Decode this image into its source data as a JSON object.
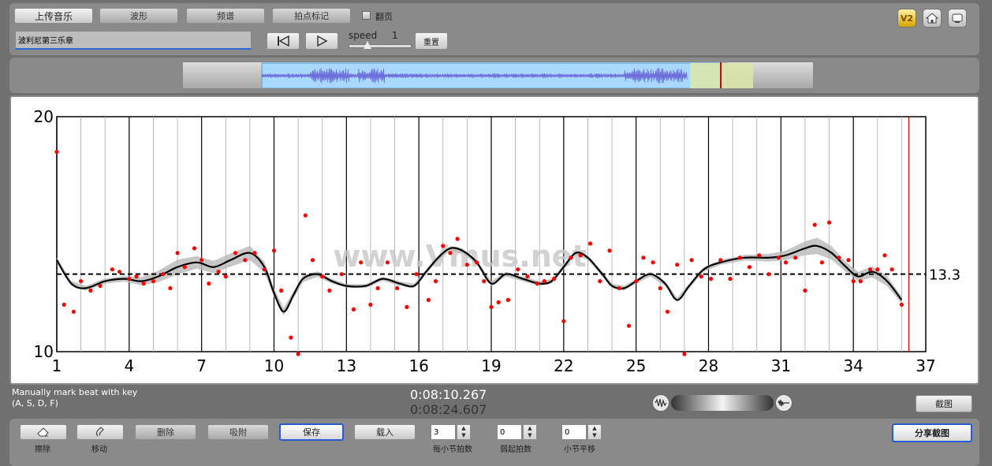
{
  "toolbar": {
    "upload_label": "上传音乐",
    "waveform_label": "波形",
    "spectrum_label": "频谱",
    "beat_mark_label": "拍点标记",
    "flip_label": "翻页",
    "title_value": "波利尼第三乐章",
    "speed_label": "speed",
    "speed_value": "1",
    "reset_label": "重置",
    "version_badge": "V2"
  },
  "chart_data": {
    "type": "line",
    "ylim": [
      10,
      20
    ],
    "xlim": [
      1,
      37
    ],
    "y_ticks": [
      "20",
      "10"
    ],
    "x_ticks": [
      "1",
      "4",
      "7",
      "10",
      "13",
      "16",
      "19",
      "22",
      "25",
      "28",
      "31",
      "34",
      "37"
    ],
    "mean_value": 13.3,
    "mean_label": "13.3",
    "watermark": "www.Vmus.net",
    "line_color": "#000000",
    "point_color": "#ff0000",
    "curve": [
      [
        1,
        13.9
      ],
      [
        1.6,
        12.9
      ],
      [
        2.2,
        12.7
      ],
      [
        3,
        13.0
      ],
      [
        3.8,
        13.1
      ],
      [
        4.5,
        13.0
      ],
      [
        5.2,
        13.2
      ],
      [
        6,
        13.6
      ],
      [
        6.8,
        13.8
      ],
      [
        7.5,
        13.6
      ],
      [
        8.2,
        13.9
      ],
      [
        9,
        14.2
      ],
      [
        9.6,
        13.6
      ],
      [
        10,
        12.5
      ],
      [
        10.4,
        11.7
      ],
      [
        10.8,
        12.4
      ],
      [
        11.2,
        13.1
      ],
      [
        11.8,
        13.3
      ],
      [
        12.4,
        13.0
      ],
      [
        13,
        12.8
      ],
      [
        13.8,
        12.8
      ],
      [
        14.5,
        13.1
      ],
      [
        15.2,
        12.9
      ],
      [
        15.8,
        12.8
      ],
      [
        16.3,
        13.4
      ],
      [
        16.8,
        14.0
      ],
      [
        17.3,
        14.4
      ],
      [
        17.8,
        14.3
      ],
      [
        18.4,
        13.8
      ],
      [
        19,
        12.9
      ],
      [
        19.6,
        13.3
      ],
      [
        20.3,
        13.1
      ],
      [
        21,
        12.9
      ],
      [
        21.5,
        13.0
      ],
      [
        22,
        13.6
      ],
      [
        22.5,
        14.2
      ],
      [
        23,
        14.0
      ],
      [
        23.6,
        13.3
      ],
      [
        24,
        12.8
      ],
      [
        24.5,
        12.7
      ],
      [
        25,
        13.0
      ],
      [
        25.6,
        13.3
      ],
      [
        26.2,
        12.9
      ],
      [
        26.7,
        12.2
      ],
      [
        27.2,
        12.8
      ],
      [
        27.8,
        13.5
      ],
      [
        28.5,
        13.8
      ],
      [
        29.5,
        14.0
      ],
      [
        30.5,
        14.0
      ],
      [
        31.2,
        14.1
      ],
      [
        32,
        14.4
      ],
      [
        32.5,
        14.5
      ],
      [
        33.1,
        14.2
      ],
      [
        33.7,
        13.6
      ],
      [
        34.2,
        13.2
      ],
      [
        34.8,
        13.4
      ],
      [
        35.4,
        13.0
      ],
      [
        36,
        12.2
      ]
    ],
    "band": [
      [
        1,
        0.12
      ],
      [
        2,
        0.1
      ],
      [
        4,
        0.12
      ],
      [
        6,
        0.32
      ],
      [
        7,
        0.25
      ],
      [
        9,
        0.3
      ],
      [
        10,
        0.18
      ],
      [
        13,
        0.08
      ],
      [
        17,
        0.1
      ],
      [
        22,
        0.1
      ],
      [
        29,
        0.1
      ],
      [
        31,
        0.18
      ],
      [
        32.5,
        0.35
      ],
      [
        34,
        0.18
      ],
      [
        35,
        0.25
      ],
      [
        36,
        0.15
      ]
    ],
    "points": [
      [
        1,
        18.5
      ],
      [
        1.3,
        12.0
      ],
      [
        1.7,
        11.7
      ],
      [
        2,
        13.0
      ],
      [
        2.4,
        12.6
      ],
      [
        2.8,
        12.8
      ],
      [
        3.3,
        13.5
      ],
      [
        3.6,
        13.4
      ],
      [
        4,
        13.1
      ],
      [
        4.3,
        13.2
      ],
      [
        4.6,
        12.9
      ],
      [
        5,
        13.0
      ],
      [
        5.4,
        13.3
      ],
      [
        5.7,
        12.7
      ],
      [
        6,
        14.2
      ],
      [
        6.3,
        13.6
      ],
      [
        6.7,
        14.4
      ],
      [
        7,
        13.9
      ],
      [
        7.3,
        12.9
      ],
      [
        7.7,
        13.4
      ],
      [
        8,
        13.2
      ],
      [
        8.4,
        14.2
      ],
      [
        8.8,
        13.9
      ],
      [
        9.2,
        14.2
      ],
      [
        9.6,
        13.5
      ],
      [
        10,
        14.3
      ],
      [
        10.3,
        12.6
      ],
      [
        10.7,
        10.6
      ],
      [
        11,
        9.9
      ],
      [
        11.3,
        15.8
      ],
      [
        11.6,
        13.9
      ],
      [
        12,
        13.2
      ],
      [
        12.3,
        12.6
      ],
      [
        12.8,
        13.3
      ],
      [
        13.3,
        11.8
      ],
      [
        13.6,
        13.8
      ],
      [
        14,
        12.0
      ],
      [
        14.3,
        12.7
      ],
      [
        14.7,
        13.8
      ],
      [
        15.1,
        12.7
      ],
      [
        15.5,
        11.9
      ],
      [
        15.9,
        13.3
      ],
      [
        16.4,
        12.2
      ],
      [
        16.7,
        13.0
      ],
      [
        17,
        14.5
      ],
      [
        17.3,
        14.2
      ],
      [
        17.6,
        14.8
      ],
      [
        18,
        13.7
      ],
      [
        18.4,
        13.8
      ],
      [
        18.7,
        13.0
      ],
      [
        19,
        11.9
      ],
      [
        19.3,
        12.1
      ],
      [
        19.7,
        12.2
      ],
      [
        20.1,
        13.5
      ],
      [
        20.5,
        13.2
      ],
      [
        20.9,
        12.9
      ],
      [
        21.2,
        13.0
      ],
      [
        21.6,
        13.1
      ],
      [
        22,
        11.3
      ],
      [
        22.3,
        14.0
      ],
      [
        22.7,
        14.1
      ],
      [
        23.1,
        14.6
      ],
      [
        23.5,
        13.0
      ],
      [
        23.9,
        14.3
      ],
      [
        24.3,
        12.7
      ],
      [
        24.7,
        11.1
      ],
      [
        25,
        13.0
      ],
      [
        25.3,
        14.0
      ],
      [
        25.7,
        13.8
      ],
      [
        26,
        12.7
      ],
      [
        26.3,
        11.7
      ],
      [
        26.7,
        13.7
      ],
      [
        27,
        9.9
      ],
      [
        27.3,
        13.9
      ],
      [
        27.7,
        13.2
      ],
      [
        28.1,
        13.1
      ],
      [
        28.5,
        13.9
      ],
      [
        28.9,
        13.1
      ],
      [
        29.3,
        14.0
      ],
      [
        29.7,
        13.6
      ],
      [
        30.1,
        14.1
      ],
      [
        30.5,
        13.3
      ],
      [
        30.9,
        14.0
      ],
      [
        31.2,
        13.8
      ],
      [
        31.6,
        14.0
      ],
      [
        32,
        12.6
      ],
      [
        32.4,
        15.4
      ],
      [
        32.7,
        13.8
      ],
      [
        33,
        15.5
      ],
      [
        33.4,
        14.0
      ],
      [
        33.8,
        13.9
      ],
      [
        34,
        13.0
      ],
      [
        34.3,
        13.0
      ],
      [
        34.7,
        13.5
      ],
      [
        35,
        13.5
      ],
      [
        35.3,
        14.1
      ],
      [
        35.6,
        13.5
      ],
      [
        36,
        12.0
      ]
    ],
    "beat_grid": {
      "major_every": 3,
      "start": 1,
      "end": 36
    }
  },
  "status": {
    "hint": "Manually mark beat with key",
    "keys": "(A, S, D, F)",
    "time_current": "0:08:10.267",
    "time_total": "0:08:24.607",
    "screenshot_label": "截图"
  },
  "bottom": {
    "erase_label": "擦除",
    "move_label": "移动",
    "delete_label": "删除",
    "snap_label": "吸附",
    "save_label": "保存",
    "load_label": "载入",
    "beats_per_bar_value": "3",
    "beats_per_bar_label": "每小节拍数",
    "weak_beats_value": "0",
    "weak_beats_label": "弱起拍数",
    "bar_shift_value": "0",
    "bar_shift_label": "小节平移",
    "share_label": "分享截图"
  }
}
